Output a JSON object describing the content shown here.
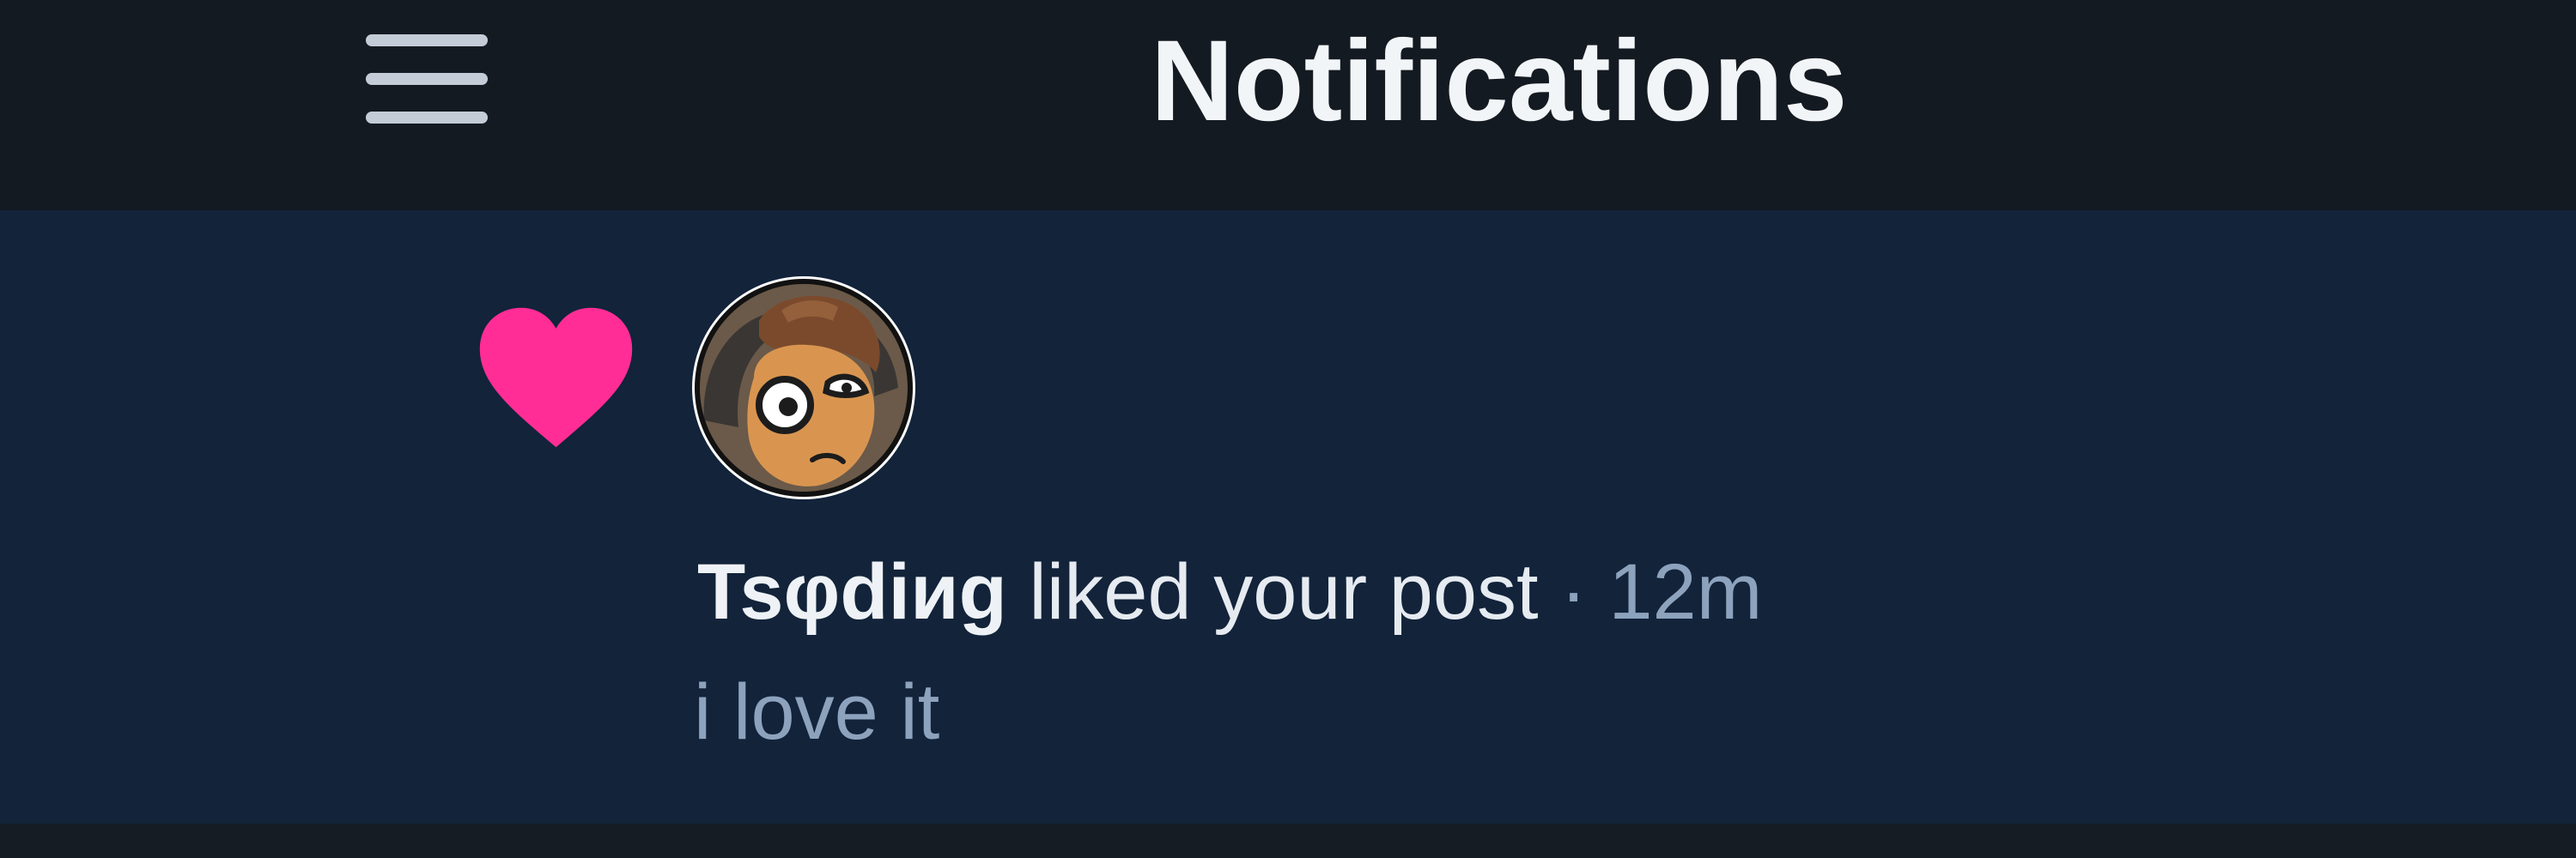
{
  "header": {
    "title": "Notifications",
    "menu_icon": "hamburger-menu-icon"
  },
  "notification": {
    "type_icon": "heart-icon",
    "icon_color": "#ff2d95",
    "avatar_icon": "avatar",
    "actor": "Tsφdiиg",
    "action": "liked your post",
    "separator": "·",
    "time": "12m",
    "excerpt": "i love it"
  },
  "colors": {
    "background": "#141a21",
    "card": "#12233a",
    "muted_text": "#8da3bd",
    "accent": "#ff2d95"
  }
}
